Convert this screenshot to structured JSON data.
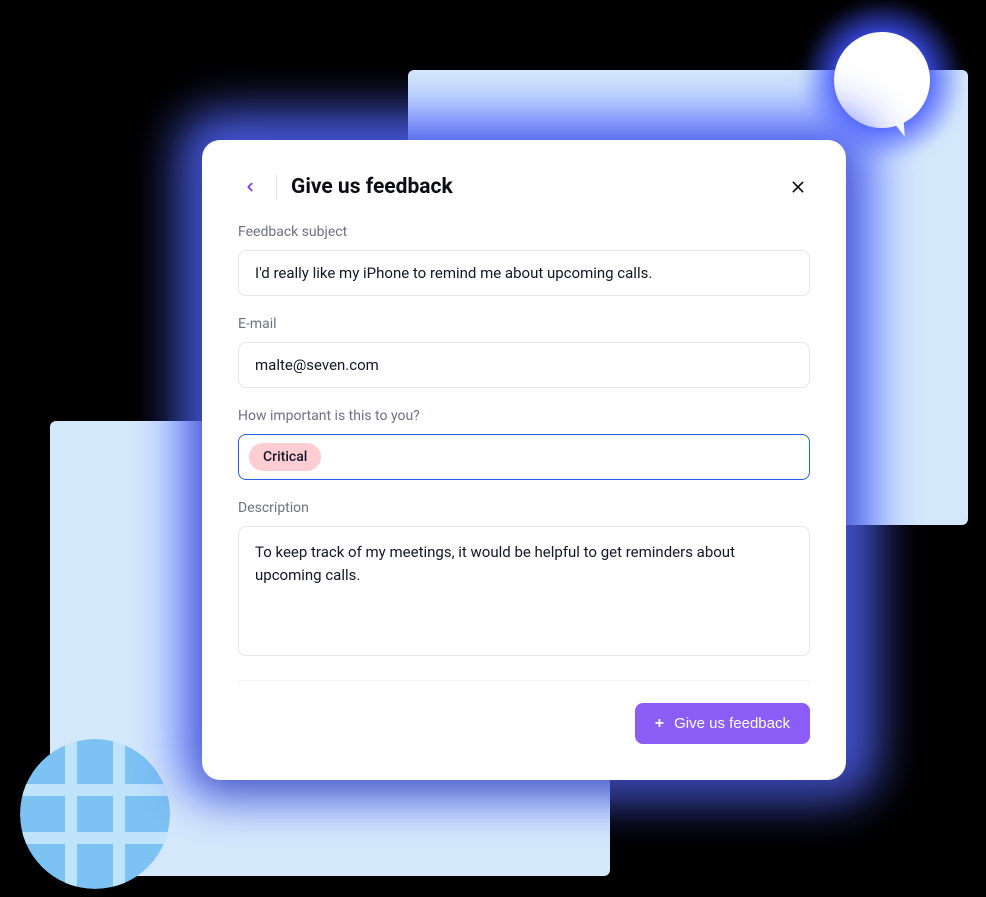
{
  "header": {
    "title": "Give us feedback"
  },
  "fields": {
    "subject": {
      "label": "Feedback subject",
      "value": "I'd really like my iPhone to remind me about upcoming calls."
    },
    "email": {
      "label": "E-mail",
      "value": "malte@seven.com"
    },
    "importance": {
      "label": "How important is this to you?",
      "chip": "Critical"
    },
    "description": {
      "label": "Description",
      "value": "To keep track of my meetings, it would be helpful to get reminders about upcoming calls."
    }
  },
  "submit": {
    "label": "Give us feedback"
  },
  "colors": {
    "accent_purple": "#8b5cf6",
    "focus_blue": "#2563eb",
    "chip_bg": "#fecdd3",
    "bg_square": "#d4e8fb",
    "glow_blue": "#5267ff"
  }
}
